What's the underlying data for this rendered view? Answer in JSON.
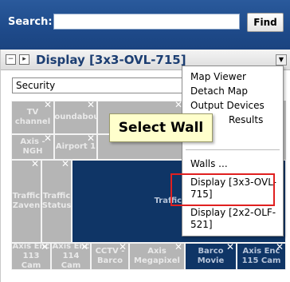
{
  "search": {
    "label": "Search:",
    "placeholder": "",
    "value": "",
    "find_label": "Find"
  },
  "panel": {
    "collapse_icon": "minus-icon",
    "expand_icon": "play-icon",
    "title": "Display [3x3-OVL-715]",
    "security_value": "Security"
  },
  "tiles": [
    {
      "label": "TV channel"
    },
    {
      "label": "Roundabout"
    },
    {
      "label": ""
    },
    {
      "label": "Axis - NGH"
    },
    {
      "label": "Airport 1"
    },
    {
      "label": ""
    },
    {
      "label": "Traffic Zaven"
    },
    {
      "label": "Traffic Status"
    },
    {
      "label": "Traffic Map"
    },
    {
      "label": "Axis Enc 113 Cam"
    },
    {
      "label": "Axis Enc 114 Cam"
    },
    {
      "label": "CCTV - Barco"
    },
    {
      "label": "Axis Megapixel"
    },
    {
      "label": "Barco Movie"
    },
    {
      "label": "Axis Enc 115 Cam"
    }
  ],
  "menu": {
    "items": [
      "Map Viewer",
      "Detach Map",
      "Output Devices",
      "Results",
      "Walls ...",
      "Display [3x3-OVL-715]",
      "Display [2x2-OLF-521]"
    ]
  },
  "tooltip": {
    "text": "Select Wall"
  },
  "colors": {
    "header_blue": "#1e4a8a",
    "selected_tile": "#0f3566",
    "highlight_red": "#e02020"
  }
}
